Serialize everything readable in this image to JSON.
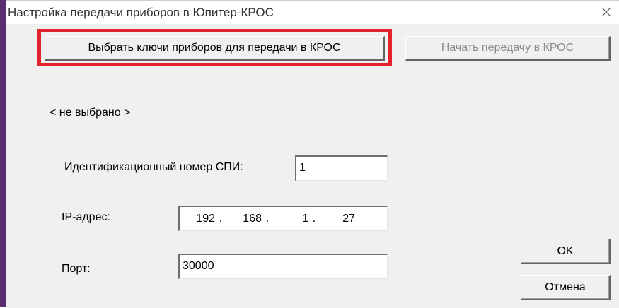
{
  "window": {
    "title": "Настройка передачи приборов в Юпитер-КРОС"
  },
  "buttons": {
    "select_keys": "Выбрать ключи приборов для передачи в КРОС",
    "start_transfer": "Начать передачу в КРОС",
    "ok": "OK",
    "cancel": "Отмена"
  },
  "selection_status": "< не выбрано >",
  "form": {
    "id_label": "Идентификационный номер СПИ:",
    "id_value": "1",
    "ip_label": "IP-адрес:",
    "ip_octets": [
      "192",
      "168",
      "1",
      "27"
    ],
    "port_label": "Порт:",
    "port_value": "30000"
  },
  "colors": {
    "highlight": "#e3222b",
    "disabled_text": "#8c8c8c",
    "dialog_bg": "#f0f0f0"
  },
  "icons": [
    "close-icon"
  ]
}
